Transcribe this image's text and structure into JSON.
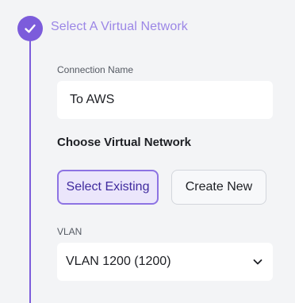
{
  "step": {
    "title": "Select A Virtual Network",
    "status_icon": "check-icon",
    "accent_color": "#7c5cdb"
  },
  "form": {
    "connection_name": {
      "label": "Connection Name",
      "value": "To AWS"
    },
    "choose_network": {
      "heading": "Choose Virtual Network",
      "options": [
        {
          "label": "Select Existing",
          "selected": true
        },
        {
          "label": "Create New",
          "selected": false
        }
      ]
    },
    "vlan": {
      "label": "VLAN",
      "selected_value": "VLAN 1200 (1200)",
      "dropdown_icon": "chevron-down-icon"
    }
  }
}
